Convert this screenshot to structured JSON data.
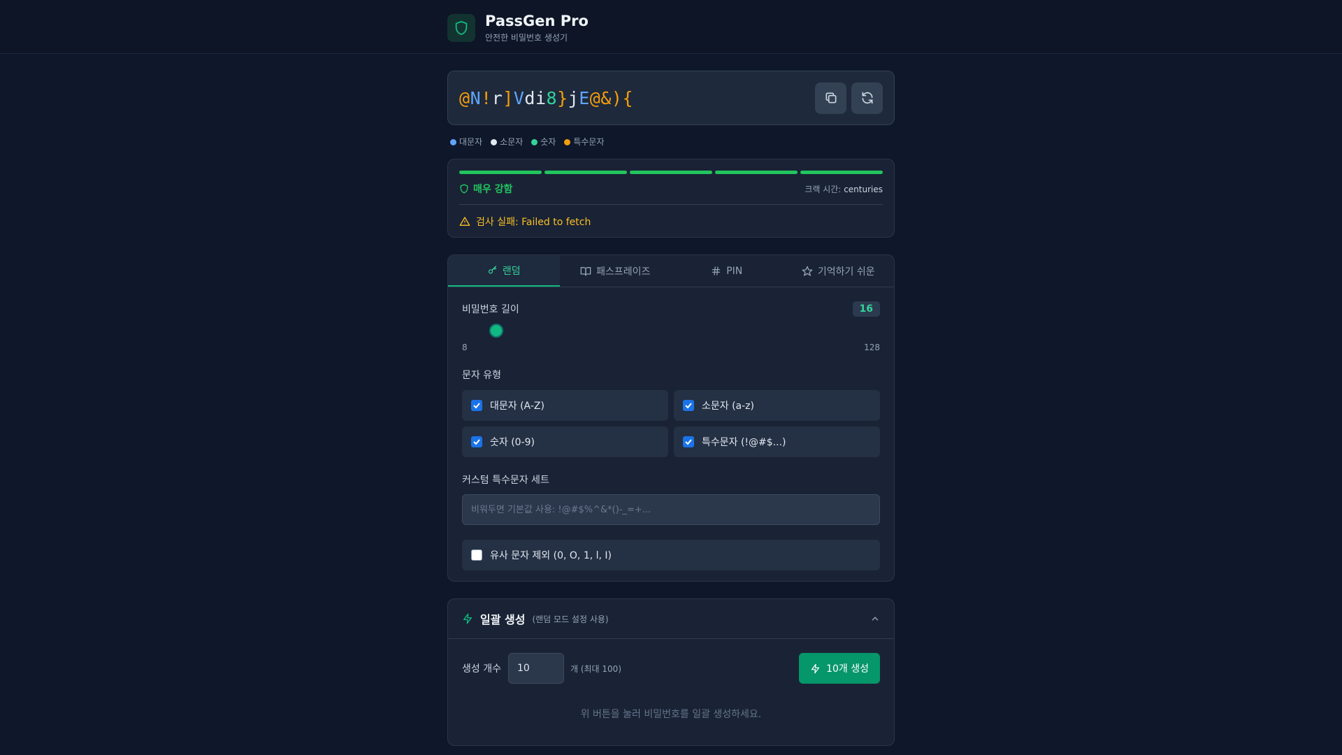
{
  "app": {
    "title": "PassGen Pro",
    "subtitle": "안전한 비밀번호 생성기",
    "accent": "#10b981"
  },
  "password": {
    "chars": [
      {
        "c": "@",
        "t": "sym"
      },
      {
        "c": "N",
        "t": "up"
      },
      {
        "c": "!",
        "t": "sym"
      },
      {
        "c": "r",
        "t": "low"
      },
      {
        "c": "]",
        "t": "sym"
      },
      {
        "c": "V",
        "t": "up"
      },
      {
        "c": "d",
        "t": "low"
      },
      {
        "c": "i",
        "t": "low"
      },
      {
        "c": "8",
        "t": "num"
      },
      {
        "c": "}",
        "t": "sym"
      },
      {
        "c": "j",
        "t": "low"
      },
      {
        "c": "E",
        "t": "up"
      },
      {
        "c": "@",
        "t": "sym"
      },
      {
        "c": "&",
        "t": "sym"
      },
      {
        "c": ")",
        "t": "sym"
      },
      {
        "c": "{",
        "t": "sym"
      }
    ],
    "copy_icon": "copy-icon",
    "refresh_icon": "refresh-icon"
  },
  "legend": {
    "uppercase": "대문자",
    "lowercase": "소문자",
    "number": "숫자",
    "symbol": "특수문자",
    "colors": {
      "uppercase": "#60a5fa",
      "lowercase": "#e2e8f0",
      "number": "#34d399",
      "symbol": "#f59e0b"
    }
  },
  "strength": {
    "label": "매우 강함",
    "segments_filled": 5,
    "segments_total": 5,
    "crack_label": "크랙 시간:",
    "crack_value": "centuries",
    "warning": "검사 실패: Failed to fetch",
    "color": "#22c55e"
  },
  "tabs": [
    {
      "label": "랜덤",
      "icon": "key-icon",
      "active": true
    },
    {
      "label": "패스프레이즈",
      "icon": "book-icon",
      "active": false
    },
    {
      "label": "PIN",
      "icon": "hash-icon",
      "active": false
    },
    {
      "label": "기억하기 쉬운",
      "icon": "star-icon",
      "active": false
    }
  ],
  "options": {
    "length_label": "비밀번호 길이",
    "length_value": "16",
    "length_min": "8",
    "length_max": "128",
    "char_types_label": "문자 유형",
    "types": [
      {
        "label": "대문자 (A-Z)",
        "checked": true
      },
      {
        "label": "소문자 (a-z)",
        "checked": true
      },
      {
        "label": "숫자 (0-9)",
        "checked": true
      },
      {
        "label": "특수문자 (!@#$...)",
        "checked": true
      }
    ],
    "custom_label": "커스텀 특수문자 세트",
    "custom_placeholder": "비워두면 기본값 사용: !@#$%^&*()-_=+...",
    "exclude_similar": {
      "label": "유사 문자 제외 (0, O, 1, l, I)",
      "checked": false
    }
  },
  "batch": {
    "title": "일괄 생성",
    "hint": "(랜덤 모드 설정 사용)",
    "count_label": "생성 개수",
    "count_value": "10",
    "count_suffix": "개 (최대 100)",
    "button_label": "10개 생성",
    "empty_text": "위 버튼을 눌러 비밀번호를 일괄 생성하세요."
  }
}
